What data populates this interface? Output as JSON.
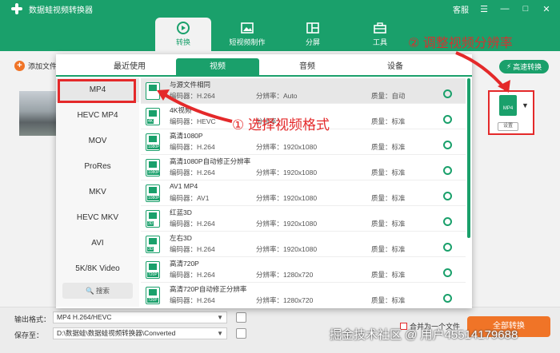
{
  "app": {
    "title": "数据蛙视频转换器",
    "help": "客服",
    "controls": [
      "☰",
      "—",
      "□",
      "✕"
    ]
  },
  "nav": {
    "tabs": [
      {
        "label": "转换",
        "icon": "convert-icon"
      },
      {
        "label": "短视频制作",
        "icon": "short-video-icon"
      },
      {
        "label": "分屏",
        "icon": "split-screen-icon"
      },
      {
        "label": "工具",
        "icon": "toolbox-icon"
      }
    ]
  },
  "toolbar": {
    "add_file": "添加文件",
    "fast_convert": "高速转换"
  },
  "format_box": {
    "label": "MP4",
    "settings": "设置"
  },
  "popup": {
    "tabs": [
      "最近使用",
      "视频",
      "音频",
      "设备"
    ],
    "active_tab": "视频",
    "categories": [
      "MP4",
      "HEVC MP4",
      "MOV",
      "ProRes",
      "MKV",
      "HEVC MKV",
      "AVI",
      "5K/8K Video"
    ],
    "search": "搜索",
    "codec_label": "编码器：",
    "res_label": "分辨率：",
    "qual_label": "质量：",
    "formats": [
      {
        "name": "与源文件相同",
        "codec": "H.264",
        "res": "Auto",
        "quality": "自动",
        "badge": ""
      },
      {
        "name": "4K视频",
        "codec": "HEVC",
        "res": "",
        "quality": "标准",
        "badge": "4K"
      },
      {
        "name": "高清1080P",
        "codec": "H.264",
        "res": "1920x1080",
        "quality": "标准",
        "badge": "1080P"
      },
      {
        "name": "高清1080P自动修正分辨率",
        "codec": "H.264",
        "res": "1920x1080",
        "quality": "标准",
        "badge": "1080P"
      },
      {
        "name": "AV1 MP4",
        "codec": "AV1",
        "res": "1920x1080",
        "quality": "标准",
        "badge": "1080P"
      },
      {
        "name": "红蓝3D",
        "codec": "H.264",
        "res": "1920x1080",
        "quality": "标准",
        "badge": "3D"
      },
      {
        "name": "左右3D",
        "codec": "H.264",
        "res": "1920x1080",
        "quality": "标准",
        "badge": "3D"
      },
      {
        "name": "高清720P",
        "codec": "H.264",
        "res": "1280x720",
        "quality": "标准",
        "badge": "720P"
      },
      {
        "name": "高清720P自动修正分辨率",
        "codec": "H.264",
        "res": "1280x720",
        "quality": "标准",
        "badge": "720P"
      }
    ]
  },
  "bottom": {
    "output_label": "输出格式：",
    "output_value": "MP4 H.264/HEVC",
    "save_label": "保存至：",
    "save_value": "D:\\数据蛙\\数据蛙视频转换器\\Converted",
    "merge": "合并为一个文件",
    "convert_all": "全部转换"
  },
  "annotations": {
    "step1": "① 选择视频格式",
    "step2": "② 调整视频分辨率"
  },
  "watermark": "掘金技术社区 @ 用户45514179688",
  "colors": {
    "brand": "#1aa06b",
    "accent": "#f07427",
    "annotation": "#e4292a"
  }
}
